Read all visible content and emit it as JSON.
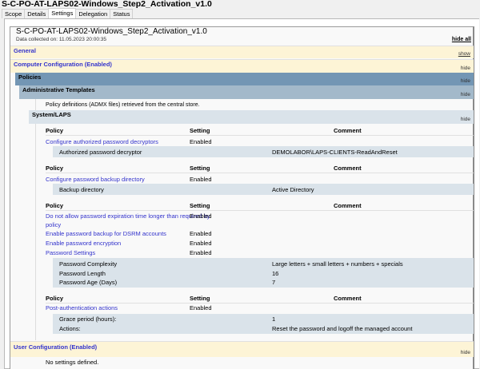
{
  "window_title": "S-C-PO-AT-LAPS02-Windows_Step2_Activation_v1.0",
  "tabs": [
    "Scope",
    "Details",
    "Settings",
    "Delegation",
    "Status"
  ],
  "report": {
    "title": "S-C-PO-AT-LAPS02-Windows_Step2_Activation_v1.0",
    "collected": "Data collected on: 11.05.2023 20:00:35",
    "hide_all": "hide all"
  },
  "general": {
    "label": "General",
    "toggle": "show"
  },
  "computer": {
    "label": "Computer Configuration (Enabled)",
    "toggle": "hide"
  },
  "policies": {
    "label": "Policies",
    "toggle": "hide"
  },
  "admin": {
    "label": "Administrative Templates",
    "toggle": "hide",
    "note": "Policy definitions (ADMX files) retrieved from the central store."
  },
  "laps": {
    "label": "System/LAPS",
    "toggle": "hide"
  },
  "cols": {
    "policy": "Policy",
    "setting": "Setting",
    "comment": "Comment"
  },
  "g1": {
    "policy": "Configure authorized password decryptors",
    "setting": "Enabled",
    "d1_label": "Authorized password decryptor",
    "d1_value": "DEMOLABOR\\LAPS-CLIENTS-ReadAndReset"
  },
  "g2": {
    "policy": "Configure password backup directory",
    "setting": "Enabled",
    "d1_label": "Backup directory",
    "d1_value": "Active Directory"
  },
  "g3": {
    "p1a": "Do not allow password expiration time longer than required by",
    "p1b": "policy",
    "s1": "Enabled",
    "p2": "Enable password backup for DSRM accounts",
    "s2": "Enabled",
    "p3": "Enable password encryption",
    "s3": "Enabled",
    "p4": "Password Settings",
    "s4": "Enabled",
    "d1_label": "Password Complexity",
    "d1_value": "Large letters + small letters + numbers + specials",
    "d2_label": "Password Length",
    "d2_value": "16",
    "d3_label": "Password Age (Days)",
    "d3_value": "7"
  },
  "g4": {
    "policy": "Post-authentication actions",
    "setting": "Enabled",
    "d1_label": "Grace period (hours):",
    "d1_value": "1",
    "d2_label": "Actions:",
    "d2_value": "Reset the password and logoff the managed account"
  },
  "user": {
    "label": "User Configuration (Enabled)",
    "toggle": "hide",
    "note": "No settings defined."
  }
}
